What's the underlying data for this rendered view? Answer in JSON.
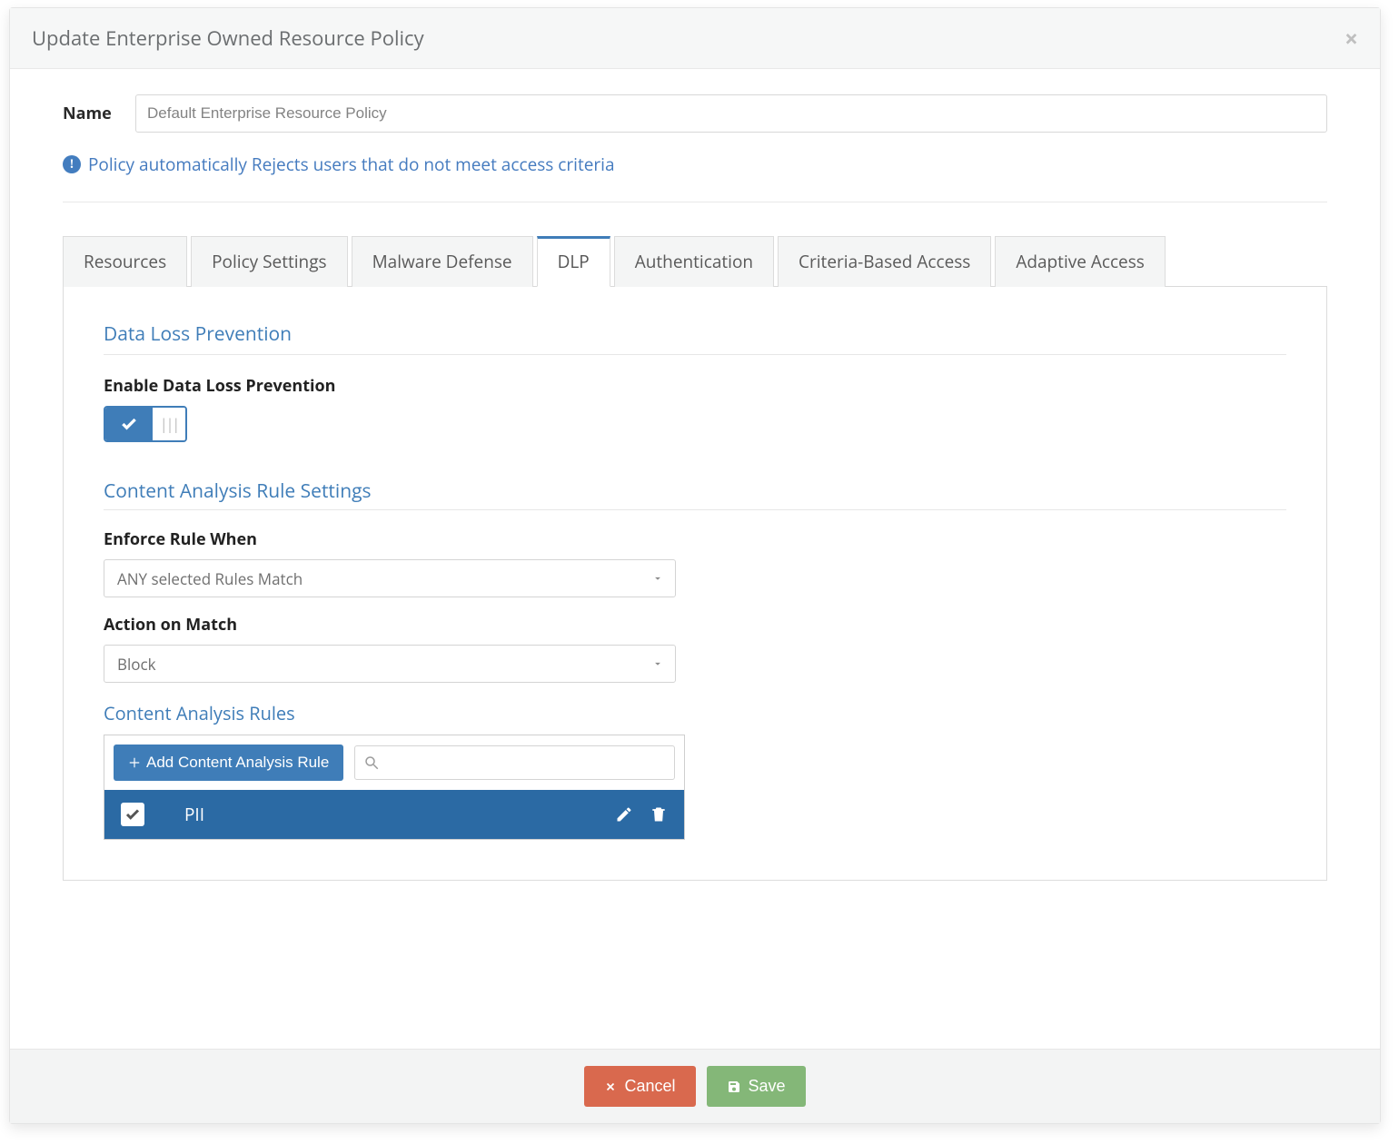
{
  "dialog": {
    "title": "Update Enterprise Owned Resource Policy"
  },
  "form": {
    "name_label": "Name",
    "name_value": "Default Enterprise Resource Policy",
    "info_text": "Policy automatically Rejects users that do not meet access criteria"
  },
  "tabs": [
    {
      "label": "Resources",
      "active": false
    },
    {
      "label": "Policy Settings",
      "active": false
    },
    {
      "label": "Malware Defense",
      "active": false
    },
    {
      "label": "DLP",
      "active": true
    },
    {
      "label": "Authentication",
      "active": false
    },
    {
      "label": "Criteria-Based Access",
      "active": false
    },
    {
      "label": "Adaptive Access",
      "active": false
    }
  ],
  "dlp": {
    "section_title": "Data Loss Prevention",
    "enable_label": "Enable Data Loss Prevention",
    "enabled": true,
    "rule_settings_title": "Content Analysis Rule Settings",
    "enforce_label": "Enforce Rule When",
    "enforce_value": "ANY selected Rules Match",
    "action_label": "Action on Match",
    "action_value": "Block",
    "rules_title": "Content Analysis Rules",
    "add_button": "Add Content Analysis Rule",
    "search_placeholder": "",
    "rules": [
      {
        "name": "PII",
        "checked": true
      }
    ]
  },
  "footer": {
    "cancel": "Cancel",
    "save": "Save"
  }
}
